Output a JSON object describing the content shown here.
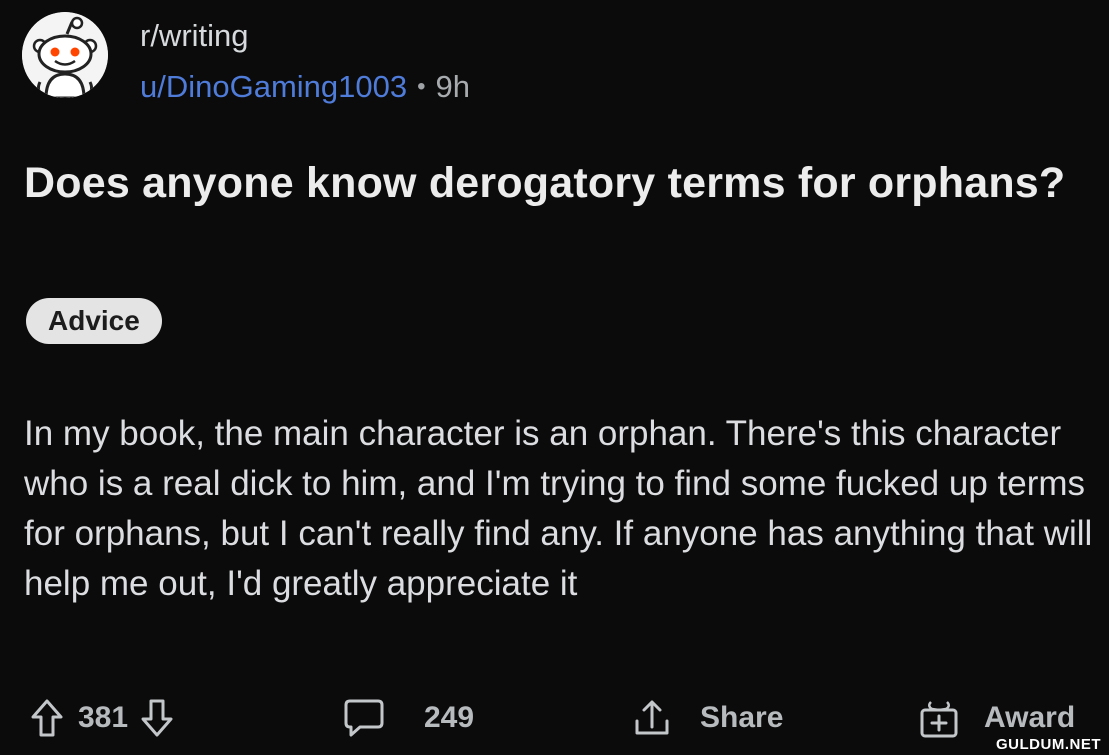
{
  "header": {
    "subreddit": "r/writing",
    "username": "u/DinoGaming1003",
    "separator": "•",
    "time": "9h"
  },
  "post": {
    "title": "Does anyone know derogatory terms for orphans?",
    "flair": "Advice",
    "body": "In my book, the main character is an orphan. There's this character who is a real dick to him, and I'm trying to find some fucked up terms for orphans, but I can't really find any. If anyone has anything that will help me out, I'd greatly appreciate it"
  },
  "actions": {
    "vote_count": "381",
    "comment_count": "249",
    "share_label": "Share",
    "award_label": "Award"
  },
  "watermark": "GULDUM.NET",
  "icons": {
    "avatar": "reddit-snoo-avatar-icon",
    "upvote": "arrow-up-icon",
    "downvote": "arrow-down-icon",
    "comment": "speech-bubble-icon",
    "share": "share-upload-icon",
    "award": "gift-award-icon"
  },
  "colors": {
    "background": "#0b0b0c",
    "username": "#4f7bd9",
    "flair_bg": "#e4e4e4",
    "text": "#dcdde0"
  }
}
